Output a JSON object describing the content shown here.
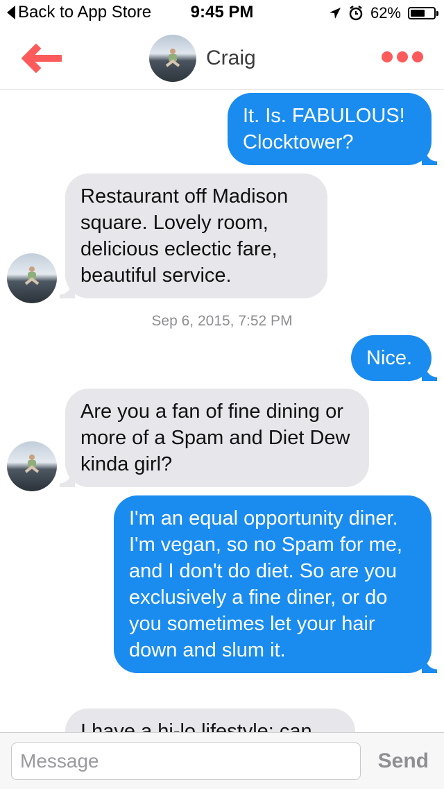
{
  "status_bar": {
    "back_label": "Back to App Store",
    "time": "9:45 PM",
    "battery": "62%",
    "battery_level": 0.62,
    "icons": [
      "location-arrow-icon",
      "alarm-clock-icon",
      "battery-icon"
    ]
  },
  "nav": {
    "back_icon": "back-arrow-icon",
    "contact_name": "Craig",
    "more_icon": "more-dots-icon",
    "accent_color": "#fd5b5b"
  },
  "messages": [
    {
      "direction": "outgoing",
      "text": "It. Is. FABULOUS! Clocktower?"
    },
    {
      "direction": "incoming",
      "text": "Restaurant off Madison square. Lovely room, delicious eclectic fare, beautiful service."
    },
    {
      "type": "timestamp",
      "text": "Sep 6, 2015, 7:52 PM"
    },
    {
      "direction": "outgoing",
      "text": "Nice."
    },
    {
      "direction": "incoming",
      "text": "Are you a fan of fine dining or more of a Spam and Diet Dew kinda girl?"
    },
    {
      "direction": "outgoing",
      "text": "I'm an equal opportunity diner. I'm vegan, so no Spam for me, and I don't do diet. So are you exclusively a fine diner, or do you sometimes let your hair down and slum it."
    },
    {
      "direction": "incoming",
      "text": "I have a hi-lo lifestyle: can"
    }
  ],
  "composer": {
    "placeholder": "Message",
    "send_label": "Send"
  },
  "colors": {
    "outgoing_bubble": "#1a8cf0",
    "incoming_bubble": "#e6e6eb"
  }
}
